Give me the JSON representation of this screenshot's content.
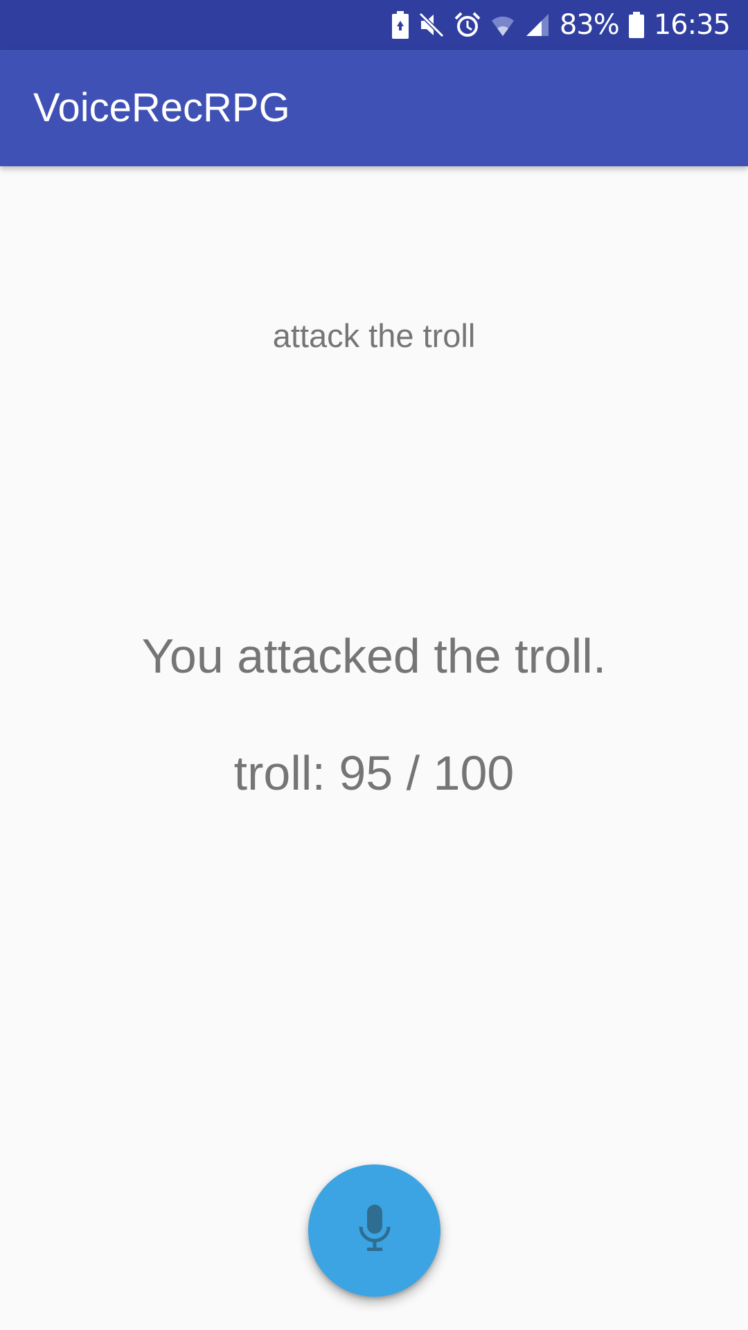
{
  "status_bar": {
    "battery_percent": "83%",
    "time": "16:35",
    "icons": [
      "battery-saver-icon",
      "mute-icon",
      "alarm-icon",
      "wifi-icon",
      "signal-icon",
      "battery-icon"
    ]
  },
  "app_bar": {
    "title": "VoiceRecRPG"
  },
  "main": {
    "command": "attack the troll",
    "result": "You attacked the troll.",
    "enemy_status": "troll: 95 / 100"
  },
  "fab": {
    "icon": "microphone-icon"
  },
  "colors": {
    "status_bar": "#303F9F",
    "app_bar": "#3F51B5",
    "background": "#FAFAFA",
    "text": "#757575",
    "fab": "#3DA4E3",
    "fab_icon": "#2F6E90"
  }
}
